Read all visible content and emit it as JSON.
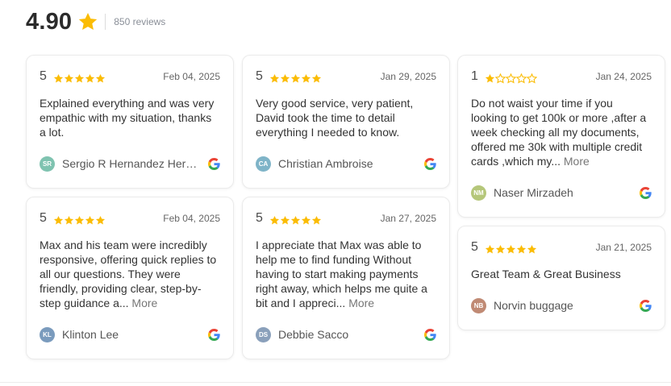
{
  "summary": {
    "rating": "4.90",
    "review_count": "850 reviews",
    "star_icon": "star-icon"
  },
  "colors": {
    "star": "#FBBC04",
    "star_empty": "#FBBC04"
  },
  "columns": [
    [
      {
        "score": "5",
        "stars": 5,
        "date": "Feb 04, 2025",
        "text": "Explained everything and was very empathic with my situation, thanks a lot.",
        "more": "",
        "initials": "SR",
        "avatar_color": "#7fc3b0",
        "name": "Sergio R Hernandez Hernández"
      },
      {
        "score": "5",
        "stars": 5,
        "date": "Feb 04, 2025",
        "text": "Max and his team were incredibly responsive, offering quick replies to all our questions. They were friendly, providing clear, step-by-step guidance a...",
        "more": "More",
        "initials": "KL",
        "avatar_color": "#7a9bbd",
        "name": "Klinton Lee"
      }
    ],
    [
      {
        "score": "5",
        "stars": 5,
        "date": "Jan 29, 2025",
        "text": "Very good service, very patient, David took the time to detail everything I needed to know.",
        "more": "",
        "initials": "CA",
        "avatar_color": "#7fb4c8",
        "name": "Christian Ambroise"
      },
      {
        "score": "5",
        "stars": 5,
        "date": "Jan 27, 2025",
        "text": "I appreciate that Max was able to help me to find funding Without having to start making payments right away, which helps me quite a bit and I appreci...",
        "more": "More",
        "initials": "DS",
        "avatar_color": "#8aa0bb",
        "name": "Debbie Sacco"
      }
    ],
    [
      {
        "score": "1",
        "stars": 1,
        "date": "Jan 24, 2025",
        "text": "Do not waist your time if you looking to get 100k or more ,after a week checking all my documents, offered me 30k with multiple credit cards ,which my...",
        "more": "More",
        "initials": "NM",
        "avatar_color": "#b5c77a",
        "name": "Naser Mirzadeh"
      },
      {
        "score": "5",
        "stars": 5,
        "date": "Jan 21, 2025",
        "text": "Great Team & Great Business",
        "more": "",
        "initials": "NB",
        "avatar_color": "#c08a74",
        "name": "Norvin buggage"
      }
    ]
  ]
}
